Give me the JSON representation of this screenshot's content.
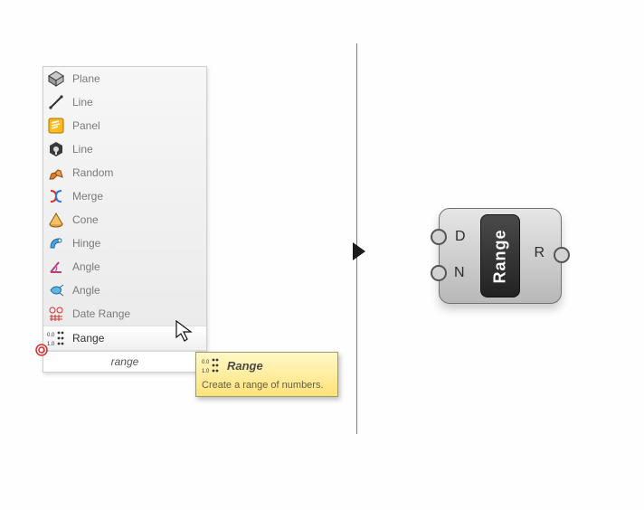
{
  "menu": {
    "items": [
      {
        "icon": "plane",
        "label": "Plane"
      },
      {
        "icon": "line",
        "label": "Line"
      },
      {
        "icon": "panel",
        "label": "Panel"
      },
      {
        "icon": "wrench",
        "label": "Line"
      },
      {
        "icon": "random",
        "label": "Random"
      },
      {
        "icon": "merge",
        "label": "Merge"
      },
      {
        "icon": "cone",
        "label": "Cone"
      },
      {
        "icon": "hinge",
        "label": "Hinge"
      },
      {
        "icon": "angle",
        "label": "Angle"
      },
      {
        "icon": "angle2",
        "label": "Angle"
      },
      {
        "icon": "daterange",
        "label": "Date Range"
      },
      {
        "icon": "range",
        "label": "Range"
      }
    ],
    "highlighted_index": 11,
    "search_value": "range"
  },
  "tooltip": {
    "title": "Range",
    "body": "Create a range of numbers."
  },
  "component": {
    "label": "Range",
    "inputs": [
      "D",
      "N"
    ],
    "outputs": [
      "R"
    ]
  }
}
